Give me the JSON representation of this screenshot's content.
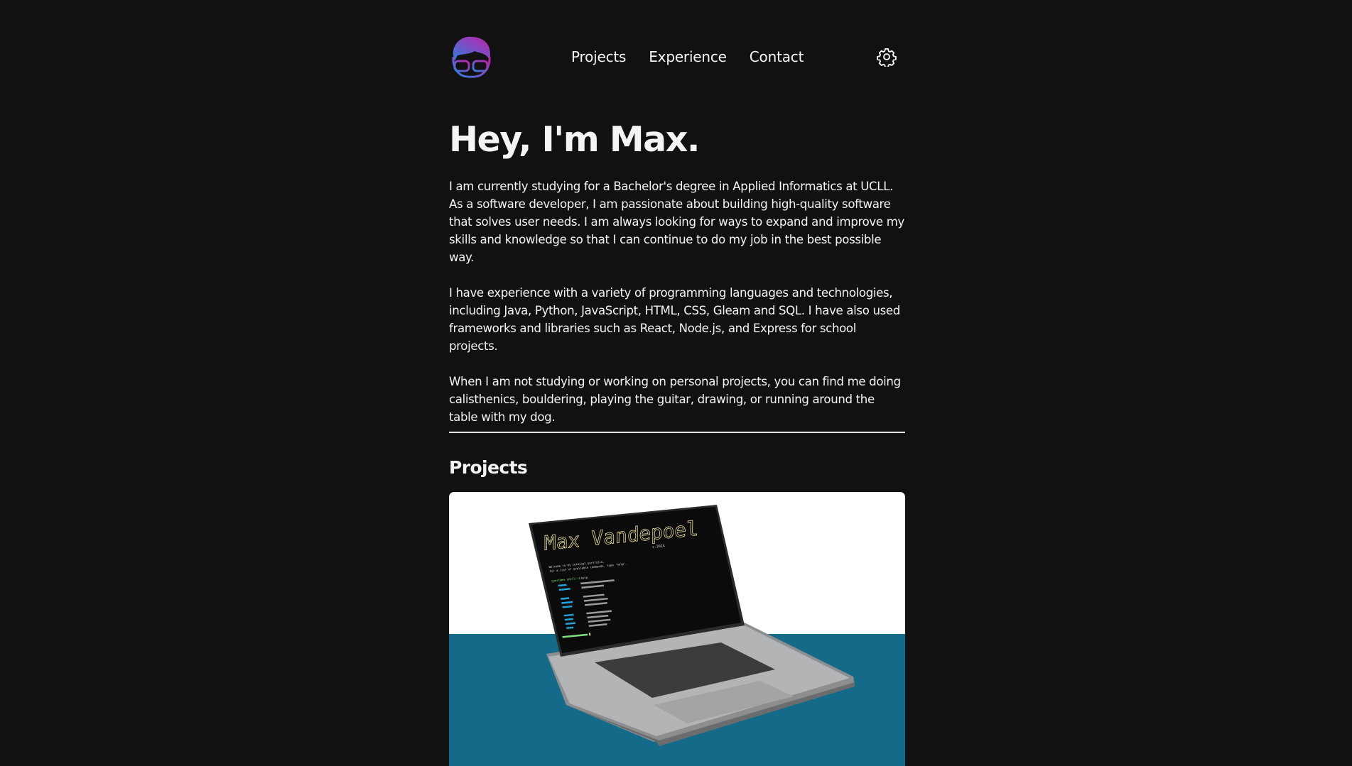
{
  "nav": {
    "items": [
      {
        "label": "Projects"
      },
      {
        "label": "Experience"
      },
      {
        "label": "Contact"
      }
    ]
  },
  "hero": {
    "title": "Hey, I'm Max.",
    "paragraphs": [
      "I am currently studying for a Bachelor's degree in Applied Informatics at UCLL. As a software developer, I am passionate about building high-quality software that solves user needs. I am always looking for ways to expand and improve my skills and knowledge so that I can continue to do my job in the best possible way.",
      "I have experience with a variety of programming languages and technologies, including Java, Python, JavaScript, HTML, CSS, Gleam and SQL. I have also used frameworks and libraries such as React, Node.js, and Express for school projects.",
      "When I am not studying or working on personal projects, you can find me doing calisthenics, bouldering, playing the guitar, drawing, or running around the table with my dog."
    ]
  },
  "projects": {
    "title": "Projects",
    "screen": {
      "heading": "Max Vandepoel",
      "version": "v.2024",
      "intro_1": "Welcome to my terminal portfolio.",
      "intro_2": "For a list of available commands, type 'help'.",
      "prompt": "guest@mv-shell:~$",
      "cmd": "help"
    }
  },
  "icons": {
    "logo": "avatar-logo-icon",
    "settings": "gear-icon"
  },
  "colors": {
    "background": "#111112",
    "text": "#f4f4f5",
    "card_top": "#ffffff",
    "card_floor": "#146b89",
    "logo_gradient_start": "#2f7fe0",
    "logo_gradient_end": "#c21fa8"
  }
}
